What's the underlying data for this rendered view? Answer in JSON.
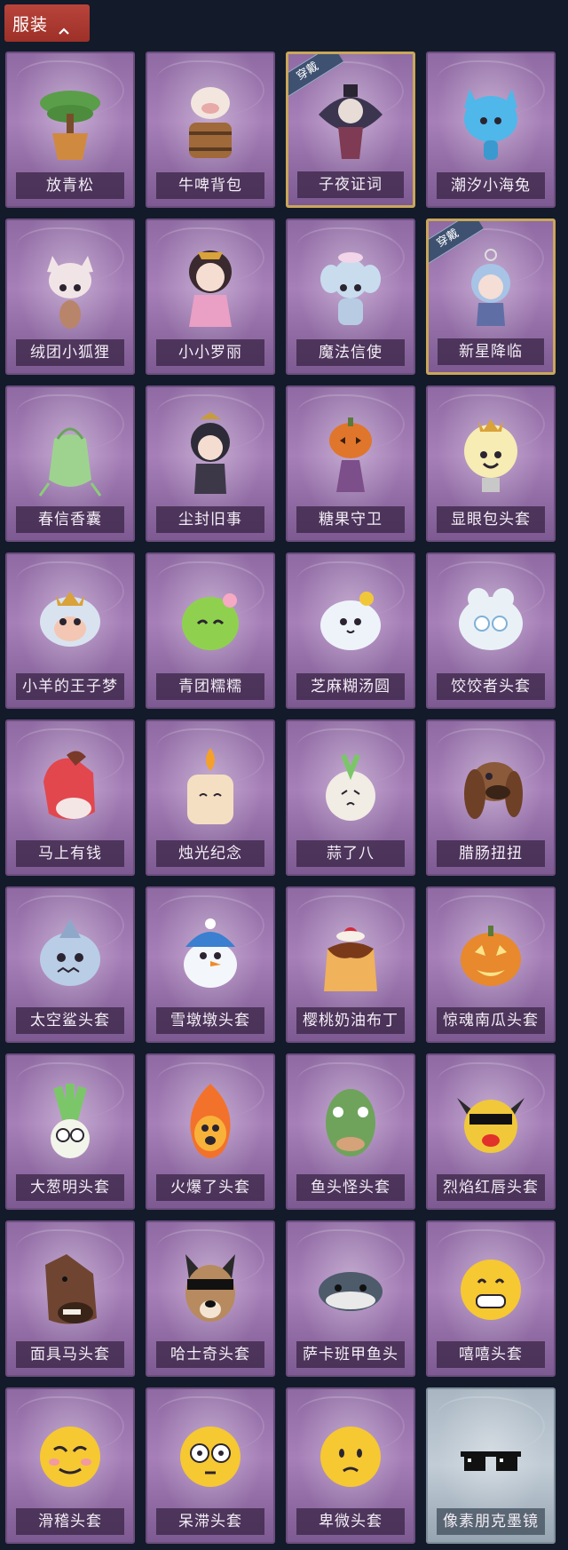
{
  "header": {
    "label": "服装"
  },
  "items": [
    {
      "name": "放青松",
      "icon": "bonsai-pine-icon",
      "color": "#5a9e4a",
      "equipped": false
    },
    {
      "name": "牛啤背包",
      "icon": "cow-beer-barrel-icon",
      "color": "#a0693a",
      "equipped": false
    },
    {
      "name": "子夜证词",
      "icon": "crow-doll-pendant-icon",
      "color": "#3b3550",
      "equipped": true,
      "equipped_label": "穿戴"
    },
    {
      "name": "潮汐小海兔",
      "icon": "sea-bunny-icon",
      "color": "#4fb7e9",
      "equipped": false
    },
    {
      "name": "绒团小狐狸",
      "icon": "fox-plush-icon",
      "color": "#f1e4e6",
      "equipped": false
    },
    {
      "name": "小小罗丽",
      "icon": "doll-girl-icon",
      "color": "#e9a0c4",
      "equipped": false
    },
    {
      "name": "魔法信使",
      "icon": "elephant-plush-icon",
      "color": "#c8dcee",
      "equipped": false
    },
    {
      "name": "新星降临",
      "icon": "star-doll-keychain-icon",
      "color": "#a7c4e6",
      "equipped": true,
      "equipped_label": "穿戴"
    },
    {
      "name": "春信香囊",
      "icon": "sachet-pouch-icon",
      "color": "#9dd38f",
      "equipped": false
    },
    {
      "name": "尘封旧事",
      "icon": "chibi-detective-icon",
      "color": "#2d2b38",
      "equipped": false
    },
    {
      "name": "糖果守卫",
      "icon": "pumpkin-scarecrow-icon",
      "color": "#e0762b",
      "equipped": false
    },
    {
      "name": "显眼包头套",
      "icon": "lightbulb-head-icon",
      "color": "#f6ecb4",
      "equipped": false
    },
    {
      "name": "小羊的王子梦",
      "icon": "sheep-crown-head-icon",
      "color": "#d9e3f0",
      "equipped": false
    },
    {
      "name": "青团糯糯",
      "icon": "green-rice-ball-icon",
      "color": "#8fd14f",
      "equipped": false
    },
    {
      "name": "芝麻糊汤圆",
      "icon": "white-rice-ball-icon",
      "color": "#eef3fa",
      "equipped": false
    },
    {
      "name": "饺饺者头套",
      "icon": "dumpling-head-icon",
      "color": "#e9f1f7",
      "equipped": false
    },
    {
      "name": "马上有钱",
      "icon": "red-horse-head-icon",
      "color": "#e2474d",
      "equipped": false
    },
    {
      "name": "烛光纪念",
      "icon": "candle-head-icon",
      "color": "#f5dfc2",
      "equipped": false
    },
    {
      "name": "蒜了八",
      "icon": "garlic-head-icon",
      "color": "#f1ece4",
      "equipped": false
    },
    {
      "name": "腊肠扭扭",
      "icon": "dachshund-head-icon",
      "color": "#8a5a3a",
      "equipped": false
    },
    {
      "name": "太空鲨头套",
      "icon": "shark-head-icon",
      "color": "#b9cde6",
      "equipped": false
    },
    {
      "name": "雪墩墩头套",
      "icon": "snowman-head-icon",
      "color": "#f3f6fb",
      "equipped": false
    },
    {
      "name": "樱桃奶油布丁",
      "icon": "cherry-pudding-icon",
      "color": "#f0b25a",
      "equipped": false
    },
    {
      "name": "惊魂南瓜头套",
      "icon": "jack-o-lantern-icon",
      "color": "#e7892c",
      "equipped": false
    },
    {
      "name": "大葱明头套",
      "icon": "scallion-head-icon",
      "color": "#7cc66a",
      "equipped": false
    },
    {
      "name": "火爆了头套",
      "icon": "fire-head-icon",
      "color": "#f2722b",
      "equipped": false
    },
    {
      "name": "鱼头怪头套",
      "icon": "fish-mask-icon",
      "color": "#6fa35c",
      "equipped": false
    },
    {
      "name": "烈焰红唇头套",
      "icon": "pikachu-sunglasses-icon",
      "color": "#f0c83a",
      "equipped": false
    },
    {
      "name": "面具马头套",
      "icon": "horse-mask-icon",
      "color": "#6f4532",
      "equipped": false
    },
    {
      "name": "哈士奇头套",
      "icon": "husky-sunglasses-icon",
      "color": "#b78a5f",
      "equipped": false
    },
    {
      "name": "萨卡班甲鱼头",
      "icon": "fish-blob-head-icon",
      "color": "#4d5b6b",
      "equipped": false
    },
    {
      "name": "嘻嘻头套",
      "icon": "grin-emoji-icon",
      "color": "#f6c832",
      "equipped": false
    },
    {
      "name": "滑稽头套",
      "icon": "funny-emoji-icon",
      "color": "#f6c832",
      "equipped": false
    },
    {
      "name": "呆滞头套",
      "icon": "dazed-emoji-icon",
      "color": "#f6c832",
      "equipped": false
    },
    {
      "name": "卑微头套",
      "icon": "humble-emoji-icon",
      "color": "#f6c832",
      "equipped": false
    },
    {
      "name": "像素朋克墨镜",
      "icon": "pixel-sunglasses-icon",
      "color": "#111111",
      "equipped": false,
      "variant": "grey"
    }
  ]
}
